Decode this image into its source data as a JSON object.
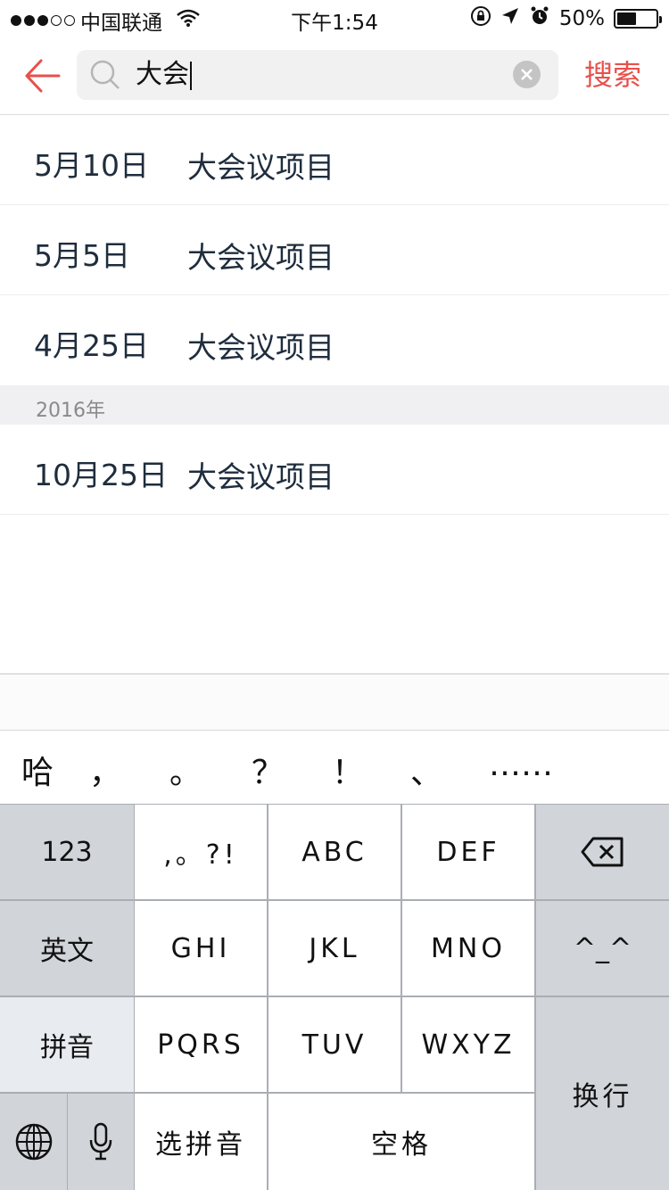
{
  "status_bar": {
    "carrier": "中国联通",
    "time": "下午1:54",
    "battery_text": "50%",
    "battery_level": 0.5
  },
  "search": {
    "query": "大会",
    "submit_label": "搜索"
  },
  "results": {
    "items": [
      {
        "date": "5月10日",
        "title": "大会议项目"
      },
      {
        "date": "5月5日",
        "title": "大会议项目"
      },
      {
        "date": "4月25日",
        "title": "大会议项目"
      }
    ],
    "year_header": "2016年",
    "items_2016": [
      {
        "date": "10月25日",
        "title": "大会议项目"
      }
    ]
  },
  "candidates": [
    "哈",
    "，",
    "。",
    "？",
    "！",
    "、",
    "……"
  ],
  "keyboard": {
    "row1": [
      "123",
      ",。?!",
      "ABC",
      "DEF"
    ],
    "row2": [
      "英文",
      "GHI",
      "JKL",
      "MNO",
      "^_^"
    ],
    "row3": [
      "拼音",
      "PQRS",
      "TUV",
      "WXYZ"
    ],
    "row4": [
      "选拼音",
      "空格"
    ],
    "enter": "换行"
  },
  "colors": {
    "accent": "#e8504a",
    "text": "#1f2d3d"
  }
}
